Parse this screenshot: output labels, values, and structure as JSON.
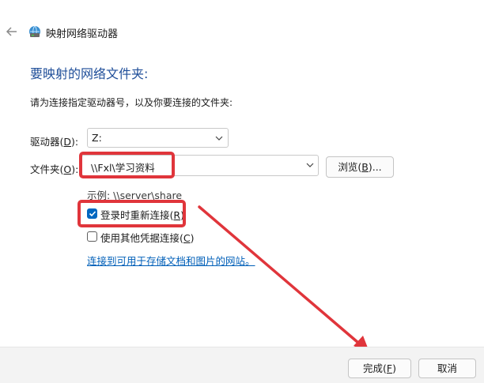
{
  "window": {
    "title": "映射网络驱动器",
    "icons": {
      "back": "back-arrow-icon",
      "app": "network-drive-icon"
    }
  },
  "main": {
    "heading": "要映射的网络文件夹:",
    "instruction": "请为连接指定驱动器号，以及你要连接的文件夹:",
    "drive": {
      "label": "驱动器",
      "shortcut": "D",
      "value": "Z:"
    },
    "folder": {
      "label": "文件夹",
      "shortcut": "O",
      "value": "\\\\Fxl\\学习资料"
    },
    "browse": {
      "label": "浏览",
      "shortcut": "B",
      "suffix": "..."
    },
    "example": "示例: \\\\server\\share",
    "reconnect": {
      "label": "登录时重新连接",
      "shortcut": "R",
      "checked": true
    },
    "credentials": {
      "label": "使用其他凭据连接",
      "shortcut": "C",
      "checked": false
    },
    "link": "连接到可用于存储文档和图片的网站。"
  },
  "footer": {
    "finish": {
      "label": "完成",
      "shortcut": "F"
    },
    "cancel": "取消"
  },
  "colors": {
    "accent": "#0067c0",
    "heading": "#1f4e99",
    "annotation": "#e0353b"
  }
}
